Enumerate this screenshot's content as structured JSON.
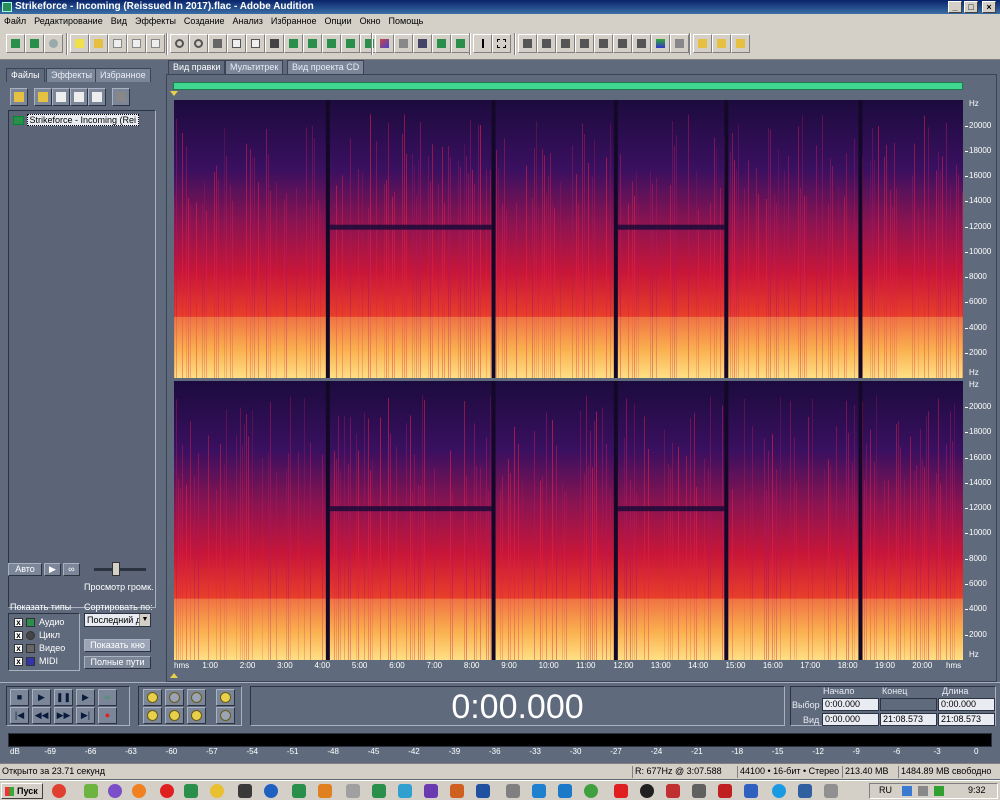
{
  "window": {
    "title": "Strikeforce - Incoming (Reissued In 2017).flac - Adobe Audition",
    "controls": [
      "_",
      "□",
      "×"
    ]
  },
  "menu": [
    "Файл",
    "Редактирование",
    "Вид",
    "Эффекты",
    "Создание",
    "Анализ",
    "Избранное",
    "Опции",
    "Окно",
    "Помощь"
  ],
  "left_panel": {
    "tabs": [
      "Файлы",
      "Эффекты",
      "Избранное"
    ],
    "file": "Strikeforce - Incoming (Rei",
    "auto_button": "Авто",
    "preview_volume": "Просмотр громк.",
    "show_types_label": "Показать типы",
    "types": [
      "Аудио",
      "Цикл",
      "Видео",
      "MIDI"
    ],
    "sort_label": "Сортировать по:",
    "sort_value": "Последний д",
    "show_button": "Показать кно",
    "fullpaths_button": "Полные пути"
  },
  "view_tabs": [
    "Вид правки",
    "Мультитрек",
    "Вид проекта CD"
  ],
  "freq_axis": {
    "unit": "Hz",
    "ticks": [
      "20000",
      "18000",
      "16000",
      "14000",
      "12000",
      "10000",
      "8000",
      "6000",
      "4000",
      "2000"
    ]
  },
  "time_axis": {
    "unit": "hms",
    "ticks": [
      "1:00",
      "2:00",
      "3:00",
      "4:00",
      "5:00",
      "6:00",
      "7:00",
      "8:00",
      "9:00",
      "10:00",
      "11:00",
      "12:00",
      "13:00",
      "14:00",
      "15:00",
      "16:00",
      "17:00",
      "18:00",
      "19:00",
      "20:00"
    ]
  },
  "transport": {
    "time": "0:00.000"
  },
  "selection": {
    "headers": [
      "Начало",
      "Конец",
      "Длина"
    ],
    "rows": [
      {
        "label": "Выбор",
        "start": "0:00.000",
        "end": "",
        "length": "0:00.000"
      },
      {
        "label": "Вид",
        "start": "0:00.000",
        "end": "21:08.573",
        "length": "21:08.573"
      }
    ]
  },
  "meter": {
    "unit": "dB",
    "ticks": [
      "-69",
      "-66",
      "-63",
      "-60",
      "-57",
      "-54",
      "-51",
      "-48",
      "-45",
      "-42",
      "-39",
      "-36",
      "-33",
      "-30",
      "-27",
      "-24",
      "-21",
      "-18",
      "-15",
      "-12",
      "-9",
      "-6",
      "-3",
      "0"
    ]
  },
  "status": {
    "opened": "Открыто за 23.71 секунд",
    "cursor": "R: 677Hz @   3:07.588",
    "format": "44100 • 16-бит • Стерео",
    "size": "213.40 MB",
    "free": "1484.89 MB свободно"
  },
  "taskbar": {
    "start": "Пуск",
    "lang": "RU",
    "clock": "9:32"
  },
  "colors": {
    "panel": "#5f6a7c",
    "overview": "#40d890",
    "spectral_low": "#1a0a3a",
    "spectral_mid": "#d4163c",
    "spectral_high": "#ffe27a"
  }
}
